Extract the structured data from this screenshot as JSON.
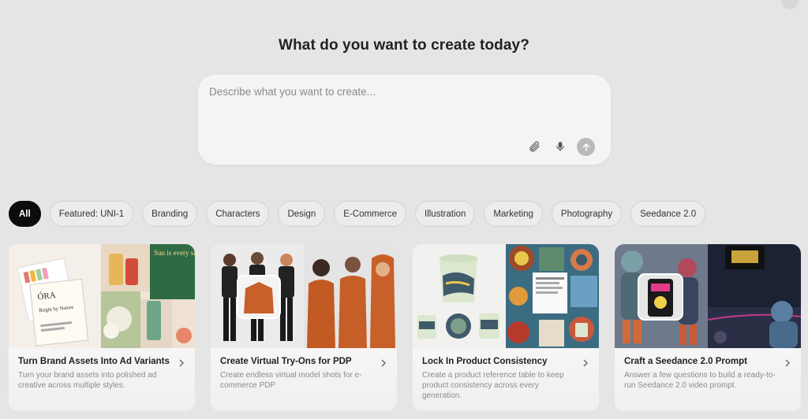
{
  "heading": "What do you want to create today?",
  "prompt": {
    "placeholder": "Describe what you want to create...",
    "value": ""
  },
  "icons": {
    "attach": "paperclip-icon",
    "mic": "microphone-icon",
    "send": "arrow-up-icon",
    "chevron": "chevron-right-icon"
  },
  "filters": [
    {
      "label": "All",
      "active": true
    },
    {
      "label": "Featured: UNI-1"
    },
    {
      "label": "Branding"
    },
    {
      "label": "Characters"
    },
    {
      "label": "Design"
    },
    {
      "label": "E-Commerce"
    },
    {
      "label": "Illustration"
    },
    {
      "label": "Marketing"
    },
    {
      "label": "Photography"
    },
    {
      "label": "Seedance 2.0"
    }
  ],
  "cards": [
    {
      "title": "Turn Brand Assets Into Ad Variants",
      "desc": "Turn your brand assets into polished ad creative across multiple styles.",
      "image_text": {
        "brand": "ÓRA",
        "tagline": "Bright by Nature",
        "poster": "Sun is every sip."
      }
    },
    {
      "title": "Create Virtual Try-Ons for PDP",
      "desc": "Create endless virtual model shots for e-commerce PDP"
    },
    {
      "title": "Lock In Product Consistency",
      "desc": "Create a product reference table to keep product consistency across every generation."
    },
    {
      "title": "Craft a Seedance 2.0 Prompt",
      "desc": "Answer a few questions to build a ready-to-run Seedance 2.0 video prompt."
    }
  ],
  "colors": {
    "background": "#e5e5e5",
    "active_chip": "#0c0c0c",
    "accent_orange": "#c8602a"
  }
}
